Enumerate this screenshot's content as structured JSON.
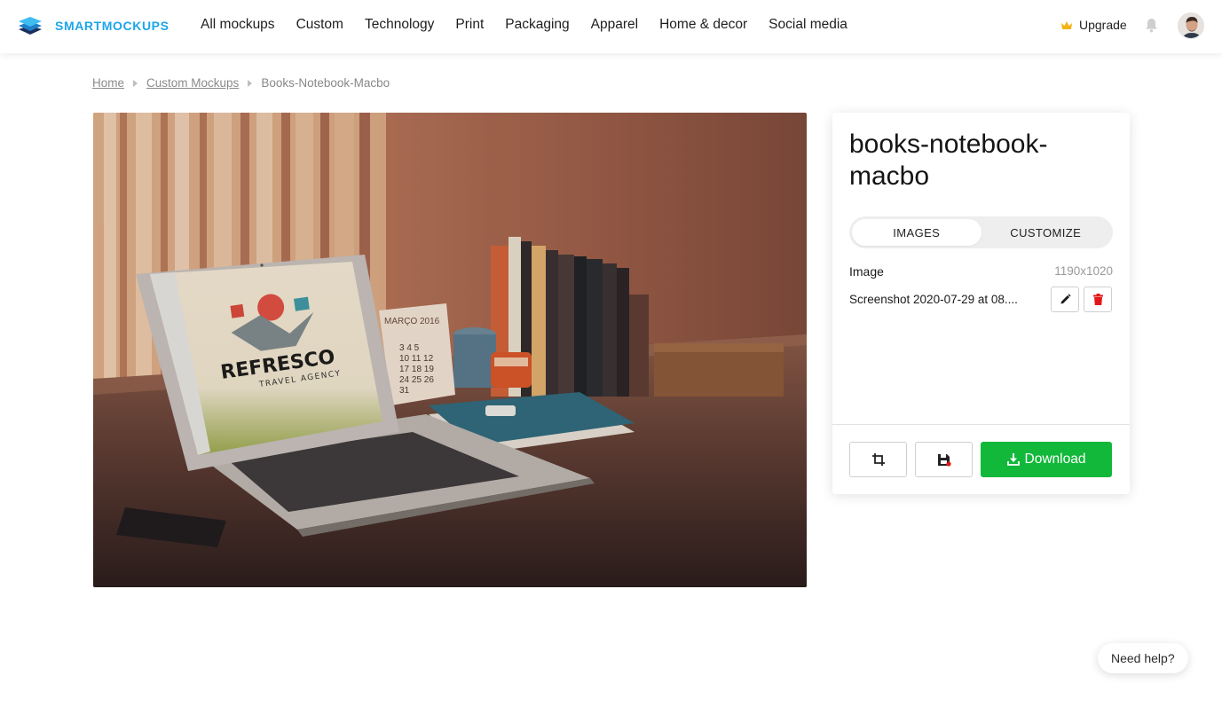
{
  "brand": {
    "name": "SMARTMOCKUPS",
    "accent": "#1ea5e9"
  },
  "nav": {
    "items": [
      "All mockups",
      "Custom",
      "Technology",
      "Print",
      "Packaging",
      "Apparel",
      "Home & decor",
      "Social media"
    ],
    "upgrade_label": "Upgrade",
    "upgrade_icon": "crown-icon",
    "bell_icon": "bell-icon"
  },
  "breadcrumb": {
    "home": "Home",
    "custom": "Custom Mockups",
    "current": "Books-Notebook-Macbo"
  },
  "mockup": {
    "screen_logo": "REFRESCO",
    "screen_tagline": "TRAVEL AGENCY",
    "calendar_header": "MARÇO 2016",
    "calendar_rows": [
      "3 4 5",
      "10 11 12",
      "17 18 19",
      "24 25 26",
      "31"
    ]
  },
  "panel": {
    "title": "books-notebook-macbo",
    "tabs": [
      "IMAGES",
      "CUSTOMIZE"
    ],
    "active_tab": "IMAGES",
    "image_label": "Image",
    "image_size": "1190x1020",
    "file_name": "Screenshot 2020-07-29 at 08....",
    "download_label": "Download",
    "download_color": "#12b83a",
    "delete_color": "#e0161a"
  },
  "help_label": "Need help?"
}
